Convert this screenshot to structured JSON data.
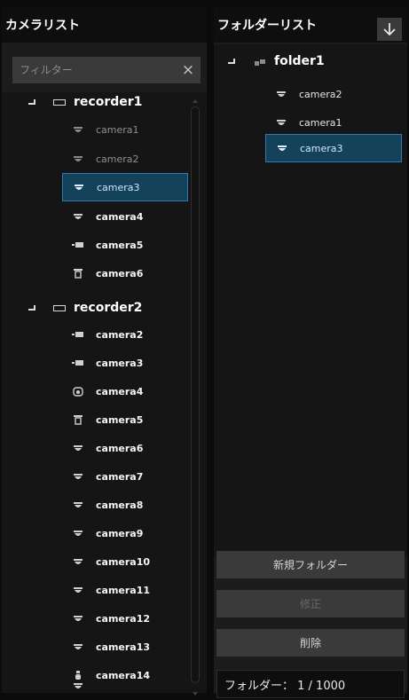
{
  "camera_list": {
    "title": "カメラリスト",
    "filter": {
      "placeholder": "フィルター",
      "clear_glyph": "×"
    },
    "recorders": [
      {
        "label": "recorder1",
        "cameras": [
          {
            "label": "camera1",
            "icon": "dome-camera-icon",
            "state": "dim"
          },
          {
            "label": "camera2",
            "icon": "dome-camera-icon",
            "state": "dim"
          },
          {
            "label": "camera3",
            "icon": "dome-camera-icon",
            "state": "selected"
          },
          {
            "label": "camera4",
            "icon": "dome-camera-icon",
            "state": "bright"
          },
          {
            "label": "camera5",
            "icon": "box-camera-icon",
            "state": "bright"
          },
          {
            "label": "camera6",
            "icon": "ptz-camera-icon",
            "state": "bright"
          }
        ]
      },
      {
        "label": "recorder2",
        "cameras": [
          {
            "label": "camera2",
            "icon": "box-camera-icon",
            "state": "bright"
          },
          {
            "label": "camera3",
            "icon": "box-camera-icon",
            "state": "bright"
          },
          {
            "label": "camera4",
            "icon": "fisheye-camera-icon",
            "state": "bright"
          },
          {
            "label": "camera5",
            "icon": "ptz-camera-icon",
            "state": "bright"
          },
          {
            "label": "camera6",
            "icon": "dome-camera-icon",
            "state": "bright"
          },
          {
            "label": "camera7",
            "icon": "dome-camera-icon",
            "state": "bright"
          },
          {
            "label": "camera8",
            "icon": "dome-camera-icon",
            "state": "bright"
          },
          {
            "label": "camera9",
            "icon": "dome-camera-icon",
            "state": "bright"
          },
          {
            "label": "camera10",
            "icon": "dome-camera-icon",
            "state": "bright"
          },
          {
            "label": "camera11",
            "icon": "dome-camera-icon",
            "state": "bright"
          },
          {
            "label": "camera12",
            "icon": "dome-camera-icon",
            "state": "bright"
          },
          {
            "label": "camera13",
            "icon": "bullet-camera-icon",
            "state": "bright"
          },
          {
            "label": "camera14",
            "icon": "dome-camera-icon",
            "state": "bright"
          }
        ]
      }
    ]
  },
  "folder_list": {
    "title": "フォルダーリスト",
    "download_icon": "down-arrow-icon",
    "folder": {
      "label": "folder1",
      "icon": "camera-group-icon",
      "cameras": [
        {
          "label": "camera2",
          "icon": "dome-camera-icon",
          "state": "normal"
        },
        {
          "label": "camera1",
          "icon": "dome-camera-icon",
          "state": "normal"
        },
        {
          "label": "camera3",
          "icon": "dome-camera-icon",
          "state": "selected"
        }
      ]
    },
    "buttons": {
      "new_folder": "新規フォルダー",
      "edit": "修正",
      "delete": "削除"
    },
    "count": {
      "label": "フォルダー：",
      "current": "1",
      "max": "1000",
      "text": "フォルダー： 1 / 1000"
    }
  },
  "colors": {
    "selection_bg": "#13425a",
    "selection_border": "#2a7bb0",
    "panel_bg": "#1c1c1c",
    "button_bg": "#3a3a3a"
  }
}
